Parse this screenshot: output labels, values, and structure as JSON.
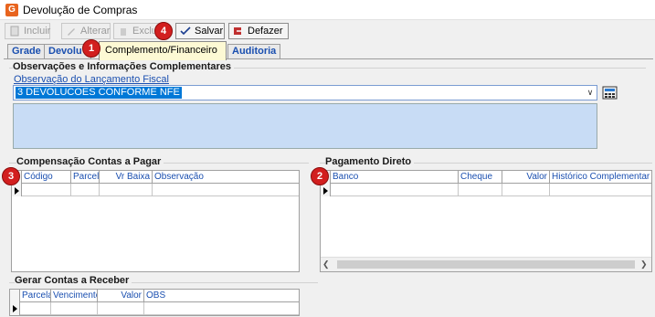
{
  "window": {
    "title": "Devolução de Compras",
    "icon_letter": "G"
  },
  "toolbar": {
    "incluir_label": "Incluir",
    "alterar_label": "Alterar",
    "excluir_label": "Exclu",
    "salvar_label": "Salvar",
    "desfazer_label": "Defazer"
  },
  "tabs": [
    {
      "label": "Grade"
    },
    {
      "label": "Devolu"
    },
    {
      "label": "Complemento/Financeiro"
    },
    {
      "label": "Auditoria"
    }
  ],
  "observacoes": {
    "title": "Observações e Informações Complementares",
    "field_label": "Observação do Lançamento Fiscal",
    "combo_value": "3 DEVOLUCOES CONFORME NFE"
  },
  "compensacao": {
    "title": "Compensação Contas a Pagar",
    "columns": [
      "Código",
      "Parcela",
      "Vr Baixa",
      "Observação"
    ]
  },
  "pagamento": {
    "title": "Pagamento Direto",
    "columns": [
      "Banco",
      "Cheque",
      "Valor",
      "Histórico Complementar"
    ]
  },
  "gerar": {
    "title": "Gerar Contas a Receber",
    "columns": [
      "Parcela",
      "Vencimento",
      "Valor",
      "OBS"
    ]
  },
  "badges": [
    "1",
    "2",
    "3",
    "4"
  ],
  "colors": {
    "badge": "#d21f1f",
    "selection": "#0078d7",
    "memo": "#c8dcf5",
    "link": "#1a4fb0"
  }
}
